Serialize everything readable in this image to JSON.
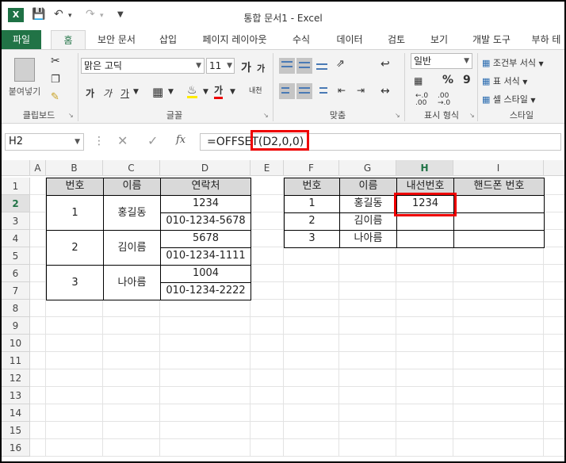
{
  "title_bar": {
    "logo": "X",
    "title": "통합 문서1 - Excel",
    "save_icon": "save-icon",
    "undo_icon": "undo-icon",
    "redo_icon": "redo-icon"
  },
  "tabs": {
    "file": "파일",
    "items": [
      "홈",
      "보안 문서",
      "삽입",
      "페이지 레이아웃",
      "수식",
      "데이터",
      "검토",
      "보기",
      "개발 도구",
      "부하 테"
    ]
  },
  "ribbon": {
    "paste": "붙여넣기",
    "clipboard": "클립보드",
    "font_name": "맑은 고딕",
    "font_size": "11",
    "font": "글꼴",
    "alignment": "맞춤",
    "number_format": "일반",
    "number": "표시 형식",
    "conditional": "조건부 서식",
    "table_format": "표 서식",
    "cell_style": "셀 스타일",
    "styles": "스타일",
    "bold": "가",
    "italic": "가",
    "underline": "가",
    "grow": "가",
    "shrink": "가",
    "font_color": "가",
    "wrap": "내천",
    "percent": "%",
    "comma": "9"
  },
  "formula_bar": {
    "name_box": "H2",
    "fx": "fx",
    "formula": "=OFFSET(D2,0,0)"
  },
  "columns": [
    "A",
    "B",
    "C",
    "D",
    "E",
    "F",
    "G",
    "H",
    "I"
  ],
  "rows": [
    "1",
    "2",
    "3",
    "4",
    "5",
    "6",
    "7",
    "8",
    "9",
    "10",
    "11",
    "12",
    "13",
    "14",
    "15",
    "16"
  ],
  "table1": {
    "headers": [
      "번호",
      "이름",
      "연락처"
    ],
    "records": [
      {
        "num": "1",
        "name": "홍길동",
        "ext": "1234",
        "phone": "010-1234-5678"
      },
      {
        "num": "2",
        "name": "김이름",
        "ext": "5678",
        "phone": "010-1234-1111"
      },
      {
        "num": "3",
        "name": "나아름",
        "ext": "1004",
        "phone": "010-1234-2222"
      }
    ]
  },
  "table2": {
    "headers": [
      "번호",
      "이름",
      "내선번호",
      "핸드폰 번호"
    ],
    "rows": [
      {
        "num": "1",
        "name": "홍길동",
        "ext": "1234",
        "phone": ""
      },
      {
        "num": "2",
        "name": "김이름",
        "ext": "",
        "phone": ""
      },
      {
        "num": "3",
        "name": "나아름",
        "ext": "",
        "phone": ""
      }
    ]
  },
  "colors": {
    "accent": "#217346",
    "highlight": "#ff0000"
  }
}
